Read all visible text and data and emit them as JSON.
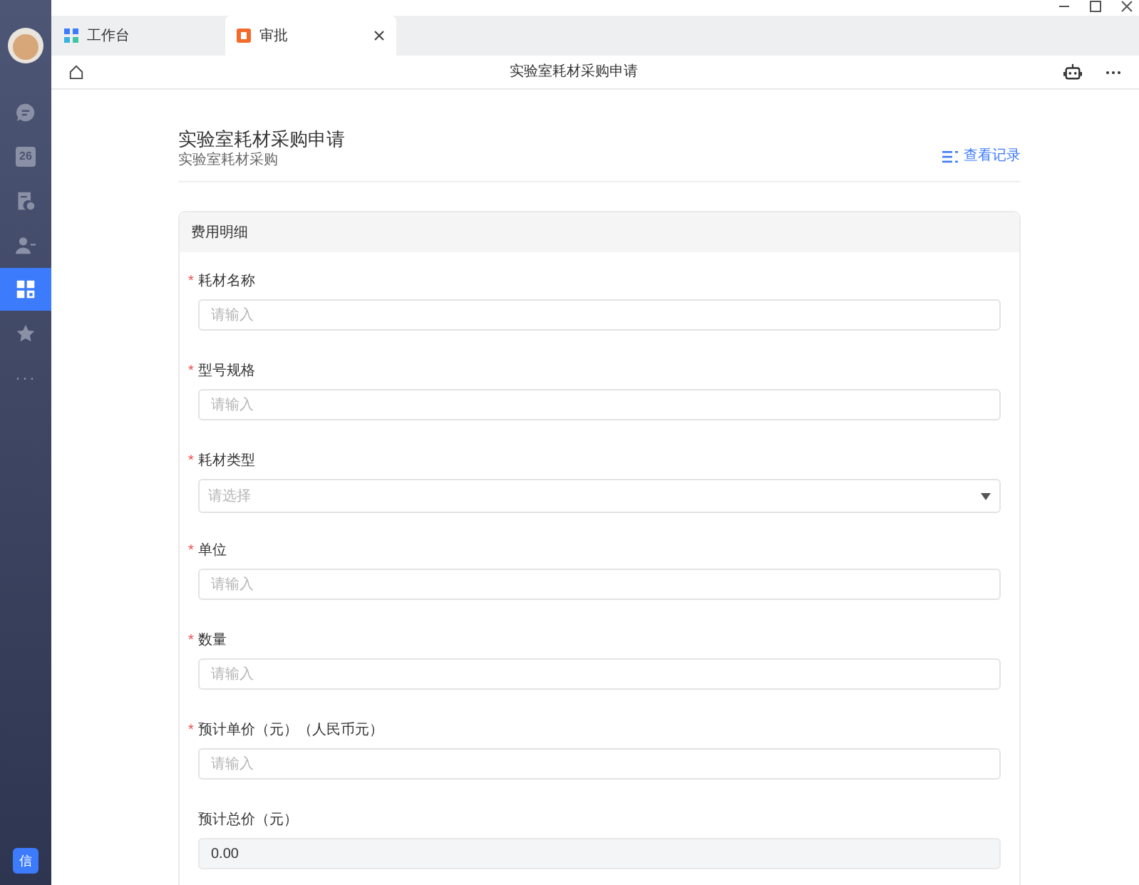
{
  "sidebar": {
    "items": [
      {
        "selected": false
      },
      {
        "selected": false,
        "text": "26"
      },
      {
        "selected": false
      },
      {
        "selected": false
      },
      {
        "selected": true
      },
      {
        "selected": false
      },
      {
        "selected": false,
        "text": "···"
      }
    ],
    "bottom_badge": "信"
  },
  "tabs": [
    {
      "label": "工作台",
      "selected": false
    },
    {
      "label": "审批",
      "selected": true
    }
  ],
  "nav": {
    "title": "实验室耗材采购申请"
  },
  "header": {
    "title": "实验室耗材采购申请",
    "subtitle": "实验室耗材采购",
    "records_link": "查看记录"
  },
  "section": {
    "title": "费用明细",
    "fields": [
      {
        "kind": "input",
        "required_mark": "*",
        "label": "耗材名称",
        "placeholder": "请输入"
      },
      {
        "kind": "input",
        "required_mark": "*",
        "label": "型号规格",
        "placeholder": "请输入"
      },
      {
        "kind": "select",
        "required_mark": "*",
        "label": "耗材类型",
        "placeholder": "请选择"
      },
      {
        "kind": "input",
        "required_mark": "*",
        "label": "单位",
        "placeholder": "请输入"
      },
      {
        "kind": "input",
        "required_mark": "*",
        "label": "数量",
        "placeholder": "请输入"
      },
      {
        "kind": "input",
        "required_mark": "*",
        "label": "预计单价（元）（人民币元）",
        "placeholder": "请输入"
      },
      {
        "kind": "readonly",
        "label": "预计总价（元）",
        "value": "0.00"
      }
    ]
  }
}
